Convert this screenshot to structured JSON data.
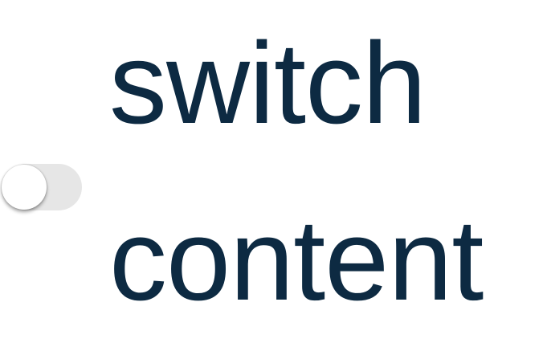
{
  "labels": {
    "top": "switch",
    "bottom": "content"
  },
  "switch": {
    "checked": false
  },
  "colors": {
    "text": "#0d2a42",
    "track_off": "#e6e6e6",
    "thumb": "#ffffff"
  }
}
